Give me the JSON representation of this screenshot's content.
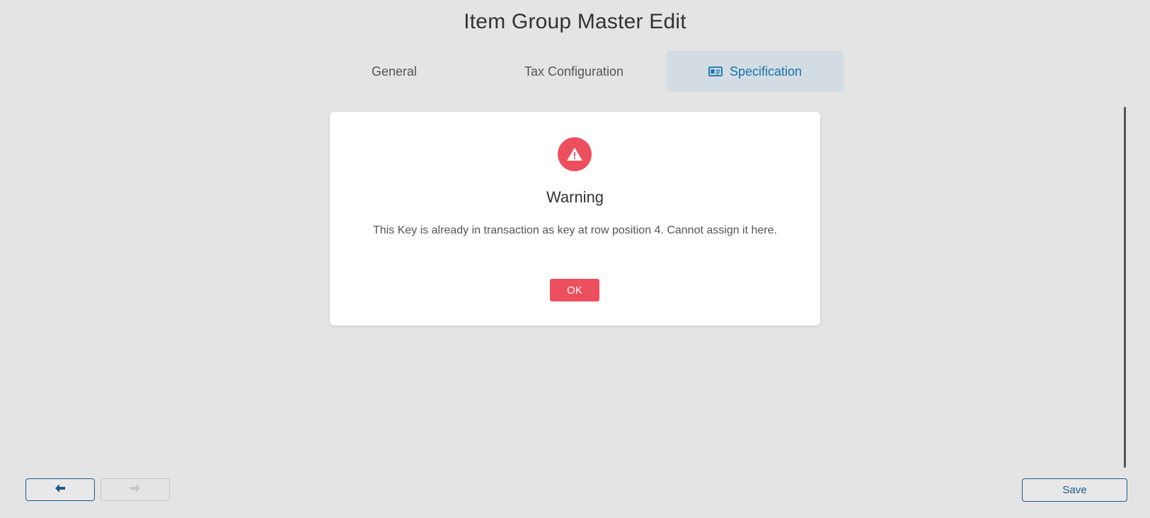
{
  "page": {
    "title": "Item Group Master Edit"
  },
  "tabs": [
    {
      "label": "General",
      "active": false
    },
    {
      "label": "Tax Configuration",
      "active": false
    },
    {
      "label": "Specification",
      "active": true,
      "icon": "id-card-icon"
    }
  ],
  "dialog": {
    "icon": "warning-triangle-icon",
    "title": "Warning",
    "message": "This Key is already in transaction as key at row position 4. Cannot assign it here.",
    "ok_label": "OK"
  },
  "footer": {
    "back_icon": "arrow-left-icon",
    "forward_icon": "arrow-right-icon",
    "forward_disabled": true,
    "save_label": "Save"
  },
  "colors": {
    "accent": "#1472b0",
    "danger": "#ed4f5f",
    "background": "#e4e4e4",
    "active_tab_bg": "#d3dce3"
  }
}
